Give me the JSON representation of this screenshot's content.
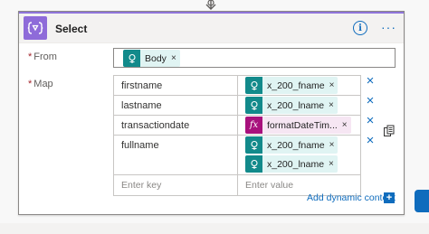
{
  "action": {
    "title": "Select",
    "info_glyph": "i",
    "more_glyph": "···"
  },
  "from": {
    "label": "From",
    "required_mark": "*",
    "token": {
      "label": "Body",
      "close": "×",
      "icon": "dynamic-content-icon"
    }
  },
  "map": {
    "label": "Map",
    "required_mark": "*",
    "rows": [
      {
        "key": "firstname",
        "tokens": [
          {
            "label": "x_200_fname",
            "close": "×",
            "kind": "dynamic"
          }
        ]
      },
      {
        "key": "lastname",
        "tokens": [
          {
            "label": "x_200_lname",
            "close": "×",
            "kind": "dynamic"
          }
        ]
      },
      {
        "key": "transactiondate",
        "tokens": [
          {
            "label": "formatDateTim...",
            "close": "×",
            "kind": "expression",
            "glyph": "fx"
          }
        ]
      },
      {
        "key": "fullname",
        "tokens": [
          {
            "label": "x_200_fname",
            "close": "×",
            "kind": "dynamic"
          },
          {
            "label": "x_200_lname",
            "close": "×",
            "kind": "dynamic"
          }
        ]
      }
    ],
    "new_row": {
      "key_placeholder": "Enter key",
      "value_placeholder": "Enter value"
    },
    "remove_glyph": "×"
  },
  "add_dynamic_content": {
    "label": "Add dynamic content",
    "plus": "+"
  },
  "colors": {
    "header_accent": "#8e74d9",
    "dynamic_token": "#128a8b",
    "expression_token": "#a8117d",
    "link": "#0f6cbd"
  }
}
